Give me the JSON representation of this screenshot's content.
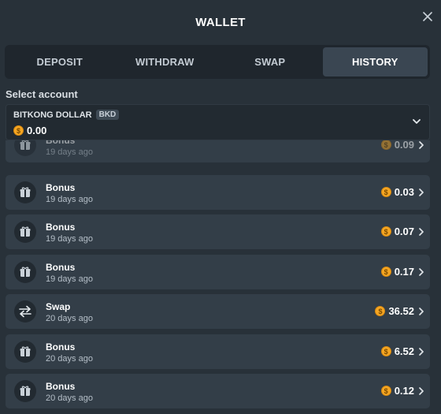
{
  "header": {
    "title": "WALLET",
    "close_icon": "close-icon"
  },
  "tabs": [
    {
      "label": "DEPOSIT",
      "active": false
    },
    {
      "label": "WITHDRAW",
      "active": false
    },
    {
      "label": "SWAP",
      "active": false
    },
    {
      "label": "HISTORY",
      "active": true
    }
  ],
  "account": {
    "select_label": "Select account",
    "name": "BITKONG DOLLAR",
    "code": "BKD",
    "balance": "0.00",
    "coin_symbol": "$"
  },
  "transactions": [
    {
      "type": "Bonus",
      "time": "19 days ago",
      "amount": "0.09",
      "icon": "gift-icon"
    },
    {
      "type": "Bonus",
      "time": "19 days ago",
      "amount": "0.03",
      "icon": "gift-icon"
    },
    {
      "type": "Bonus",
      "time": "19 days ago",
      "amount": "0.07",
      "icon": "gift-icon"
    },
    {
      "type": "Bonus",
      "time": "19 days ago",
      "amount": "0.17",
      "icon": "gift-icon"
    },
    {
      "type": "Swap",
      "time": "20 days ago",
      "amount": "36.52",
      "icon": "swap-arrows-icon"
    },
    {
      "type": "Bonus",
      "time": "20 days ago",
      "amount": "6.52",
      "icon": "gift-icon"
    },
    {
      "type": "Bonus",
      "time": "20 days ago",
      "amount": "0.12",
      "icon": "gift-icon"
    }
  ],
  "colors": {
    "background": "#283139",
    "row": "#333e48",
    "coin": "#f5a623",
    "active_tab": "#3a4652"
  }
}
